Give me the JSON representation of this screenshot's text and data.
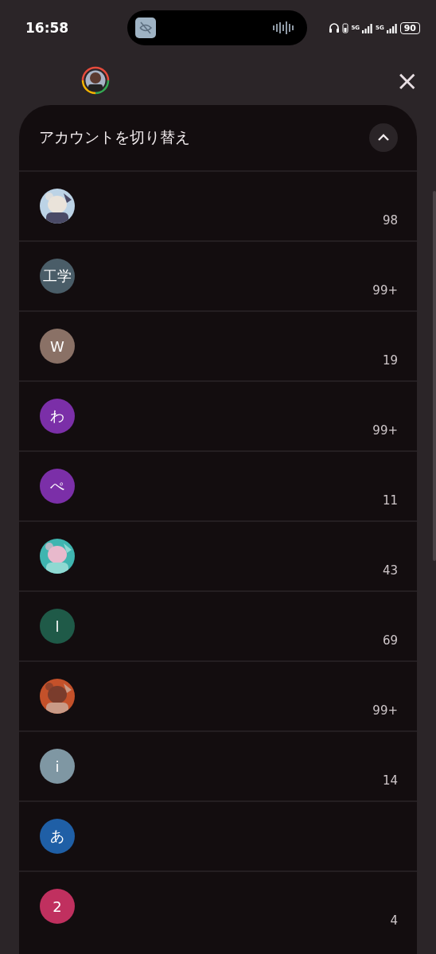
{
  "status_bar": {
    "time": "16:58",
    "network_1": "5G",
    "network_2": "5G",
    "battery": "90"
  },
  "header": {
    "close": "×"
  },
  "panel": {
    "title": "アカウントを切り替え",
    "expanded": true
  },
  "accounts": [
    {
      "count": "98"
    },
    {
      "avatar": {
        "kind": "letter",
        "letter": "工学",
        "color": "#4a5d68"
      },
      "count": "99+"
    },
    {
      "avatar": {
        "kind": "letter",
        "letter": "W",
        "color": "#8a7166"
      },
      "count": "19"
    },
    {
      "avatar": {
        "kind": "letter",
        "letter": "わ",
        "color": "#7b2fa8"
      },
      "count": "99+"
    },
    {
      "avatar": {
        "kind": "letter",
        "letter": "ぺ",
        "color": "#7b2fa8"
      },
      "count": "11"
    },
    {
      "count": "43"
    },
    {
      "avatar": {
        "kind": "letter",
        "letter": "l",
        "color": "#1f5a48"
      },
      "count": "69"
    },
    {
      "count": "99+"
    },
    {
      "avatar": {
        "kind": "letter",
        "letter": "i",
        "color": "#7f97a3"
      },
      "count": "14"
    },
    {
      "avatar": {
        "kind": "letter",
        "letter": "あ",
        "color": "#1f5fa6"
      }
    },
    {
      "avatar": {
        "kind": "letter",
        "letter": "2",
        "color": "#c0305f"
      },
      "count": "4"
    }
  ]
}
